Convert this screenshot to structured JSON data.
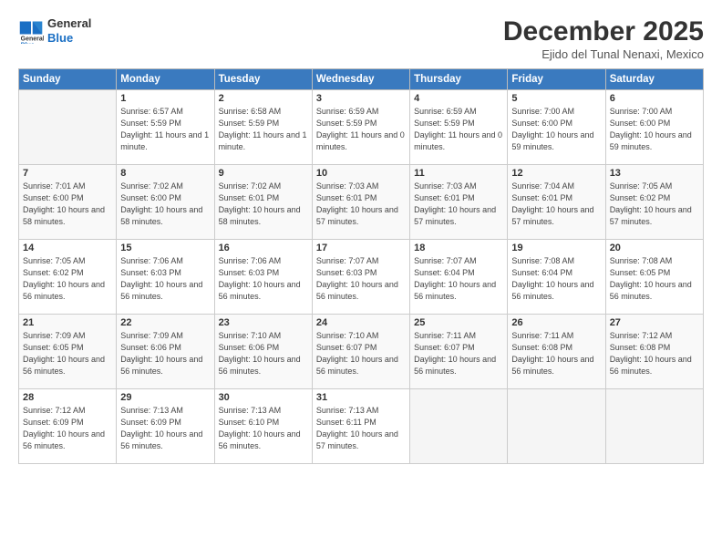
{
  "header": {
    "logo_line1": "General",
    "logo_line2": "Blue",
    "title": "December 2025",
    "subtitle": "Ejido del Tunal Nenaxi, Mexico"
  },
  "days_of_week": [
    "Sunday",
    "Monday",
    "Tuesday",
    "Wednesday",
    "Thursday",
    "Friday",
    "Saturday"
  ],
  "weeks": [
    [
      {
        "num": "",
        "empty": true
      },
      {
        "num": "1",
        "sunrise": "6:57 AM",
        "sunset": "5:59 PM",
        "daylight": "11 hours and 1 minute."
      },
      {
        "num": "2",
        "sunrise": "6:58 AM",
        "sunset": "5:59 PM",
        "daylight": "11 hours and 1 minute."
      },
      {
        "num": "3",
        "sunrise": "6:59 AM",
        "sunset": "5:59 PM",
        "daylight": "11 hours and 0 minutes."
      },
      {
        "num": "4",
        "sunrise": "6:59 AM",
        "sunset": "5:59 PM",
        "daylight": "11 hours and 0 minutes."
      },
      {
        "num": "5",
        "sunrise": "7:00 AM",
        "sunset": "6:00 PM",
        "daylight": "10 hours and 59 minutes."
      },
      {
        "num": "6",
        "sunrise": "7:00 AM",
        "sunset": "6:00 PM",
        "daylight": "10 hours and 59 minutes."
      }
    ],
    [
      {
        "num": "7",
        "sunrise": "7:01 AM",
        "sunset": "6:00 PM",
        "daylight": "10 hours and 58 minutes."
      },
      {
        "num": "8",
        "sunrise": "7:02 AM",
        "sunset": "6:00 PM",
        "daylight": "10 hours and 58 minutes."
      },
      {
        "num": "9",
        "sunrise": "7:02 AM",
        "sunset": "6:01 PM",
        "daylight": "10 hours and 58 minutes."
      },
      {
        "num": "10",
        "sunrise": "7:03 AM",
        "sunset": "6:01 PM",
        "daylight": "10 hours and 57 minutes."
      },
      {
        "num": "11",
        "sunrise": "7:03 AM",
        "sunset": "6:01 PM",
        "daylight": "10 hours and 57 minutes."
      },
      {
        "num": "12",
        "sunrise": "7:04 AM",
        "sunset": "6:01 PM",
        "daylight": "10 hours and 57 minutes."
      },
      {
        "num": "13",
        "sunrise": "7:05 AM",
        "sunset": "6:02 PM",
        "daylight": "10 hours and 57 minutes."
      }
    ],
    [
      {
        "num": "14",
        "sunrise": "7:05 AM",
        "sunset": "6:02 PM",
        "daylight": "10 hours and 56 minutes."
      },
      {
        "num": "15",
        "sunrise": "7:06 AM",
        "sunset": "6:03 PM",
        "daylight": "10 hours and 56 minutes."
      },
      {
        "num": "16",
        "sunrise": "7:06 AM",
        "sunset": "6:03 PM",
        "daylight": "10 hours and 56 minutes."
      },
      {
        "num": "17",
        "sunrise": "7:07 AM",
        "sunset": "6:03 PM",
        "daylight": "10 hours and 56 minutes."
      },
      {
        "num": "18",
        "sunrise": "7:07 AM",
        "sunset": "6:04 PM",
        "daylight": "10 hours and 56 minutes."
      },
      {
        "num": "19",
        "sunrise": "7:08 AM",
        "sunset": "6:04 PM",
        "daylight": "10 hours and 56 minutes."
      },
      {
        "num": "20",
        "sunrise": "7:08 AM",
        "sunset": "6:05 PM",
        "daylight": "10 hours and 56 minutes."
      }
    ],
    [
      {
        "num": "21",
        "sunrise": "7:09 AM",
        "sunset": "6:05 PM",
        "daylight": "10 hours and 56 minutes."
      },
      {
        "num": "22",
        "sunrise": "7:09 AM",
        "sunset": "6:06 PM",
        "daylight": "10 hours and 56 minutes."
      },
      {
        "num": "23",
        "sunrise": "7:10 AM",
        "sunset": "6:06 PM",
        "daylight": "10 hours and 56 minutes."
      },
      {
        "num": "24",
        "sunrise": "7:10 AM",
        "sunset": "6:07 PM",
        "daylight": "10 hours and 56 minutes."
      },
      {
        "num": "25",
        "sunrise": "7:11 AM",
        "sunset": "6:07 PM",
        "daylight": "10 hours and 56 minutes."
      },
      {
        "num": "26",
        "sunrise": "7:11 AM",
        "sunset": "6:08 PM",
        "daylight": "10 hours and 56 minutes."
      },
      {
        "num": "27",
        "sunrise": "7:12 AM",
        "sunset": "6:08 PM",
        "daylight": "10 hours and 56 minutes."
      }
    ],
    [
      {
        "num": "28",
        "sunrise": "7:12 AM",
        "sunset": "6:09 PM",
        "daylight": "10 hours and 56 minutes."
      },
      {
        "num": "29",
        "sunrise": "7:13 AM",
        "sunset": "6:09 PM",
        "daylight": "10 hours and 56 minutes."
      },
      {
        "num": "30",
        "sunrise": "7:13 AM",
        "sunset": "6:10 PM",
        "daylight": "10 hours and 56 minutes."
      },
      {
        "num": "31",
        "sunrise": "7:13 AM",
        "sunset": "6:11 PM",
        "daylight": "10 hours and 57 minutes."
      },
      {
        "num": "",
        "empty": true
      },
      {
        "num": "",
        "empty": true
      },
      {
        "num": "",
        "empty": true
      }
    ]
  ]
}
